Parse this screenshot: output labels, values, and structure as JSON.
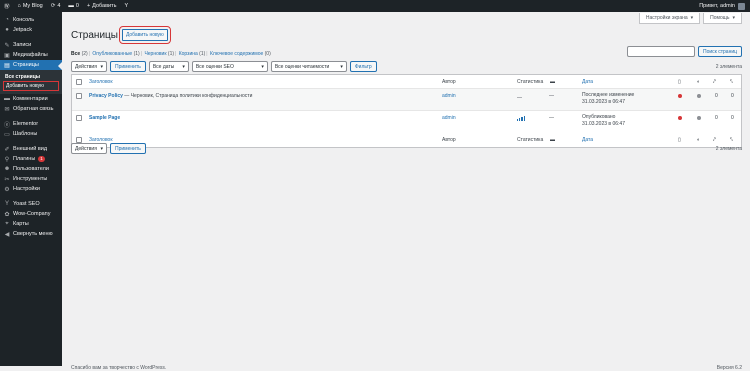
{
  "adminbar": {
    "site_name": "My Blog",
    "updates": "4",
    "comments": "0",
    "new_label": "Добавить",
    "greeting": "Привет, admin"
  },
  "sidebar": {
    "items": [
      {
        "label": "Консоль",
        "icon": "dashboard-icon",
        "glyph": "◔"
      },
      {
        "label": "Jetpack",
        "icon": "jetpack-icon",
        "glyph": "●"
      }
    ],
    "items2": [
      {
        "label": "Записи",
        "icon": "posts-icon",
        "glyph": "✎"
      },
      {
        "label": "Медиафайлы",
        "icon": "media-icon",
        "glyph": "▣"
      },
      {
        "label": "Страницы",
        "icon": "pages-icon",
        "glyph": "▤"
      }
    ],
    "sub_all": "Все страницы",
    "sub_new": "Добавить новую",
    "items3": [
      {
        "label": "Комментарии",
        "icon": "comments-icon",
        "glyph": "▬"
      },
      {
        "label": "Обратная связь",
        "icon": "feedback-icon",
        "glyph": "✉"
      }
    ],
    "items4": [
      {
        "label": "Elementor",
        "icon": "elementor-icon",
        "glyph": "ⓔ"
      },
      {
        "label": "Шаблоны",
        "icon": "templates-icon",
        "glyph": "▭"
      }
    ],
    "items5": [
      {
        "label": "Внешний вид",
        "icon": "appearance-icon",
        "glyph": "✐"
      },
      {
        "label": "Плагины",
        "icon": "plugins-icon",
        "glyph": "⚲",
        "badge": "1"
      },
      {
        "label": "Пользователи",
        "icon": "users-icon",
        "glyph": "☻"
      },
      {
        "label": "Инструменты",
        "icon": "tools-icon",
        "glyph": "✂"
      },
      {
        "label": "Настройки",
        "icon": "settings-icon",
        "glyph": "⚙"
      }
    ],
    "items6": [
      {
        "label": "Yoast SEO",
        "icon": "yoast-icon",
        "glyph": "Y"
      },
      {
        "label": "Wow-Company",
        "icon": "wow-icon",
        "glyph": "✿"
      },
      {
        "label": "Карты",
        "icon": "maps-icon",
        "glyph": "⌖"
      },
      {
        "label": "Свернуть меню",
        "icon": "collapse-icon",
        "glyph": "◀"
      }
    ]
  },
  "header": {
    "screen_options": "Настройки экрана",
    "help": "Помощь",
    "title": "Страницы",
    "add_new": "Добавить новую"
  },
  "filters": {
    "all": "Все",
    "all_count": "(2)",
    "published": "Опубликованные",
    "published_count": "(1)",
    "drafts": "Черновик",
    "drafts_count": "(1)",
    "trash": "Корзина",
    "trash_count": "(1)",
    "cornerstone": "Ключевое содержимое",
    "cornerstone_count": "(0)"
  },
  "search": {
    "button": "Поиск страниц"
  },
  "tablenav": {
    "bulk": "Действия",
    "apply": "Применить",
    "dates": "Все даты",
    "seo": "Все оценки SEO",
    "readability": "Все оценки читаемости",
    "filter": "Фильтр",
    "count": "2 элемента"
  },
  "table": {
    "headers": {
      "title": "Заголовок",
      "author": "Автор",
      "stats": "Статистика",
      "date": "Дата"
    },
    "rows": [
      {
        "title": "Privacy Policy",
        "state": " — Черновик, Страница политики конфиденциальности",
        "author": "admin",
        "stats": "—",
        "comments": "—",
        "date_status": "Последнее изменение",
        "date": "31.03.2023 в 06:47",
        "seo_color": "#d63638",
        "read_color": "#8c8f94",
        "links_out": "0",
        "links_in": "0"
      },
      {
        "title": "Sample Page",
        "state": "",
        "author": "admin",
        "stats": "",
        "comments": "—",
        "date_status": "Опубликовано",
        "date": "31.03.2023 в 06:47",
        "seo_color": "#d63638",
        "read_color": "#8c8f94",
        "links_out": "0",
        "links_in": "0"
      }
    ]
  },
  "footer": {
    "text": "Спасибо вам за творчество с WordPress.",
    "version": "Версия 6.2"
  }
}
